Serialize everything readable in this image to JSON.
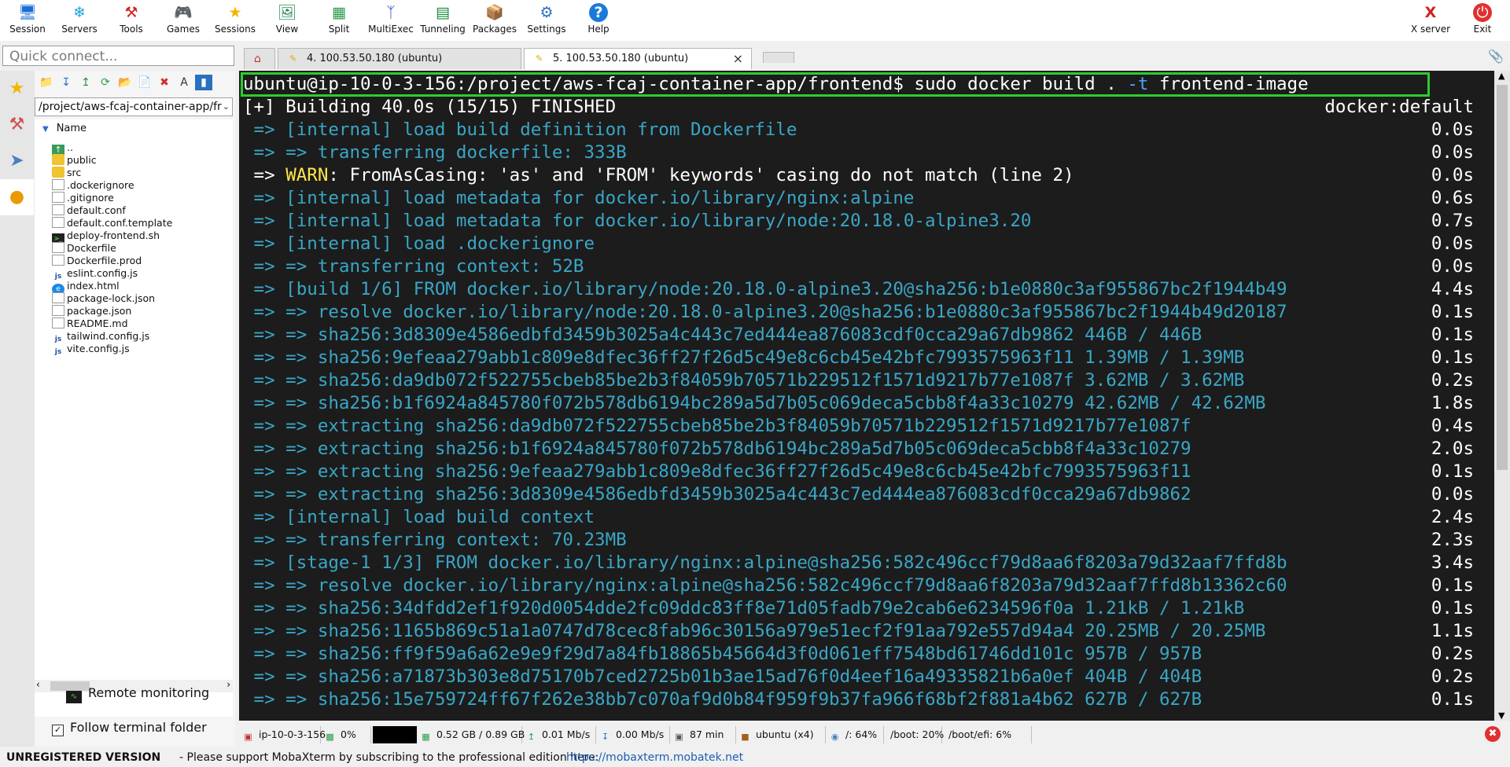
{
  "toolbar": {
    "buttons": [
      {
        "label": "Session",
        "icon": "monitor-icon"
      },
      {
        "label": "Servers",
        "icon": "servers-icon"
      },
      {
        "label": "Tools",
        "icon": "tools-icon"
      },
      {
        "label": "Games",
        "icon": "gamepad-icon"
      },
      {
        "label": "Sessions",
        "icon": "star-icon"
      },
      {
        "label": "View",
        "icon": "view-icon"
      },
      {
        "label": "Split",
        "icon": "split-icon"
      },
      {
        "label": "MultiExec",
        "icon": "multiexec-icon"
      },
      {
        "label": "Tunneling",
        "icon": "tunneling-icon"
      },
      {
        "label": "Packages",
        "icon": "packages-icon"
      },
      {
        "label": "Settings",
        "icon": "gear-icon"
      },
      {
        "label": "Help",
        "icon": "help-icon"
      }
    ],
    "xserver_label": "X server",
    "exit_label": "Exit"
  },
  "quick_connect": {
    "placeholder": "Quick connect..."
  },
  "tabs": [
    {
      "label": "4. 100.53.50.180 (ubuntu)",
      "active": false
    },
    {
      "label": "5. 100.53.50.180 (ubuntu)",
      "active": true
    }
  ],
  "sidebar": {
    "path": "/project/aws-fcaj-container-app/fr",
    "column_header": "Name",
    "files": [
      {
        "name": "..",
        "type": "up"
      },
      {
        "name": "public",
        "type": "folder"
      },
      {
        "name": "src",
        "type": "folder"
      },
      {
        "name": ".dockerignore",
        "type": "file"
      },
      {
        "name": ".gitignore",
        "type": "file"
      },
      {
        "name": "default.conf",
        "type": "file"
      },
      {
        "name": "default.conf.template",
        "type": "file"
      },
      {
        "name": "deploy-frontend.sh",
        "type": "sh"
      },
      {
        "name": "Dockerfile",
        "type": "file"
      },
      {
        "name": "Dockerfile.prod",
        "type": "file"
      },
      {
        "name": "eslint.config.js",
        "type": "js"
      },
      {
        "name": "index.html",
        "type": "html"
      },
      {
        "name": "package-lock.json",
        "type": "file"
      },
      {
        "name": "package.json",
        "type": "file"
      },
      {
        "name": "README.md",
        "type": "file"
      },
      {
        "name": "tailwind.config.js",
        "type": "js"
      },
      {
        "name": "vite.config.js",
        "type": "js"
      }
    ],
    "remote_monitoring": "Remote monitoring",
    "follow_terminal": "Follow terminal folder"
  },
  "terminal": {
    "prompt": "ubuntu@ip-10-0-3-156:/project/aws-fcaj-container-app/frontend$",
    "command_pre": "sudo docker build . ",
    "command_flag": "-t",
    "command_post": " frontend-image",
    "building": "[+] Building 40.0s (15/15) FINISHED",
    "context": "docker:default",
    "lines": [
      {
        "text": " => [internal] load build definition from Dockerfile",
        "time": "0.0s"
      },
      {
        "text": " => => transferring dockerfile: 333B",
        "time": "0.0s"
      },
      {
        "text": " => WARN: FromAsCasing: 'as' and 'FROM' keywords' casing do not match (line 2)",
        "time": "0.0s",
        "warn": true
      },
      {
        "text": " => [internal] load metadata for docker.io/library/nginx:alpine",
        "time": "0.6s"
      },
      {
        "text": " => [internal] load metadata for docker.io/library/node:20.18.0-alpine3.20",
        "time": "0.7s"
      },
      {
        "text": " => [internal] load .dockerignore",
        "time": "0.0s"
      },
      {
        "text": " => => transferring context: 52B",
        "time": "0.0s"
      },
      {
        "text": " => [build 1/6] FROM docker.io/library/node:20.18.0-alpine3.20@sha256:b1e0880c3af955867bc2f1944b49",
        "time": "4.4s"
      },
      {
        "text": " => => resolve docker.io/library/node:20.18.0-alpine3.20@sha256:b1e0880c3af955867bc2f1944b49d20187",
        "time": "0.1s"
      },
      {
        "text": " => => sha256:3d8309e4586edbfd3459b3025a4c443c7ed444ea876083cdf0cca29a67db9862 446B / 446B",
        "time": "0.1s"
      },
      {
        "text": " => => sha256:9efeaa279abb1c809e8dfec36ff27f26d5c49e8c6cb45e42bfc7993575963f11 1.39MB / 1.39MB",
        "time": "0.1s"
      },
      {
        "text": " => => sha256:da9db072f522755cbeb85be2b3f84059b70571b229512f1571d9217b77e1087f 3.62MB / 3.62MB",
        "time": "0.2s"
      },
      {
        "text": " => => sha256:b1f6924a845780f072b578db6194bc289a5d7b05c069deca5cbb8f4a33c10279 42.62MB / 42.62MB",
        "time": "1.8s"
      },
      {
        "text": " => => extracting sha256:da9db072f522755cbeb85be2b3f84059b70571b229512f1571d9217b77e1087f",
        "time": "0.4s"
      },
      {
        "text": " => => extracting sha256:b1f6924a845780f072b578db6194bc289a5d7b05c069deca5cbb8f4a33c10279",
        "time": "2.0s"
      },
      {
        "text": " => => extracting sha256:9efeaa279abb1c809e8dfec36ff27f26d5c49e8c6cb45e42bfc7993575963f11",
        "time": "0.1s"
      },
      {
        "text": " => => extracting sha256:3d8309e4586edbfd3459b3025a4c443c7ed444ea876083cdf0cca29a67db9862",
        "time": "0.0s"
      },
      {
        "text": " => [internal] load build context",
        "time": "2.4s"
      },
      {
        "text": " => => transferring context: 70.23MB",
        "time": "2.3s"
      },
      {
        "text": " => [stage-1 1/3] FROM docker.io/library/nginx:alpine@sha256:582c496ccf79d8aa6f8203a79d32aaf7ffd8b",
        "time": "3.4s"
      },
      {
        "text": " => => resolve docker.io/library/nginx:alpine@sha256:582c496ccf79d8aa6f8203a79d32aaf7ffd8b13362c60",
        "time": "0.1s"
      },
      {
        "text": " => => sha256:34dfdd2ef1f920d0054dde2fc09ddc83ff8e71d05fadb79e2cab6e6234596f0a 1.21kB / 1.21kB",
        "time": "0.1s"
      },
      {
        "text": " => => sha256:1165b869c51a1a0747d78cec8fab96c30156a979e51ecf2f91aa792e557d94a4 20.25MB / 20.25MB",
        "time": "1.1s"
      },
      {
        "text": " => => sha256:ff9f59a6a62e9e9f29d7a84fb18865b45664d3f0d061eff7548bd61746dd101c 957B / 957B",
        "time": "0.2s"
      },
      {
        "text": " => => sha256:a71873b303e8d75170b7ced2725b01b3ae15ad76f0d4eef16a49335821b6a0ef 404B / 404B",
        "time": "0.2s"
      },
      {
        "text": " => => sha256:15e759724ff67f262e38bb7c070af9d0b84f959f9b37fa966f68bf2f881a4b62 627B / 627B",
        "time": "0.1s"
      }
    ]
  },
  "statusbar": {
    "host": "ip-10-0-3-156",
    "cpu": "0%",
    "memory": "0.52 GB / 0.89 GB",
    "upload": "0.01 Mb/s",
    "download": "0.00 Mb/s",
    "uptime": "87 min",
    "users": "ubuntu (x4)",
    "disk_root": "/: 64%",
    "disk_boot": "/boot: 20%",
    "disk_efi": "/boot/efi: 6%"
  },
  "bottombar": {
    "unregistered": "UNREGISTERED VERSION",
    "message": "-  Please support MobaXterm by subscribing to the professional edition here:",
    "link": "https://mobaxterm.mobatek.net"
  },
  "colors": {
    "terminal_bg": "#1c1c1c",
    "terminal_text": "#3aa6c6",
    "highlight_box": "#2ecc2e",
    "warn": "#ffe54a"
  }
}
